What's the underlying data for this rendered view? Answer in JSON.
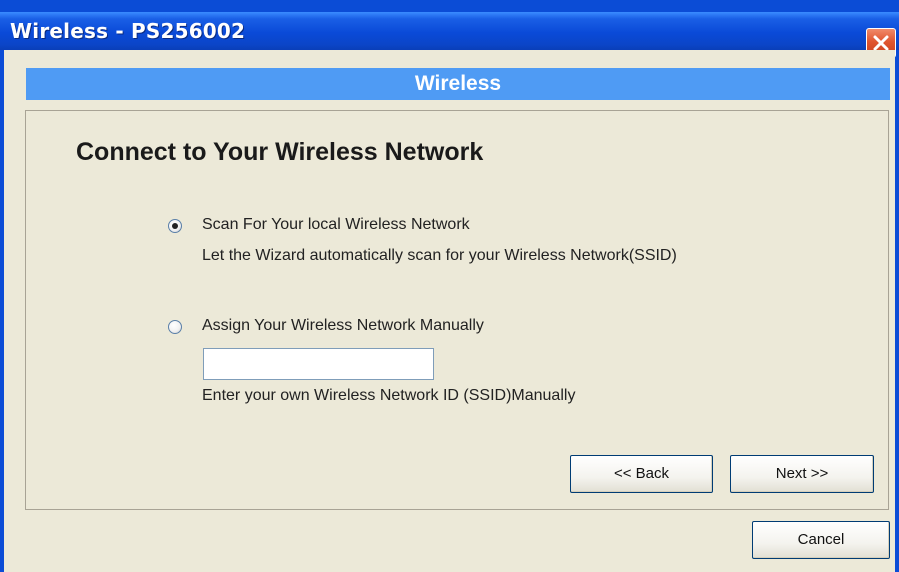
{
  "window": {
    "title": "Wireless - PS256002"
  },
  "banner": {
    "title": "Wireless"
  },
  "main": {
    "heading": "Connect to Your Wireless Network",
    "options": [
      {
        "label": "Scan For Your local Wireless Network",
        "description": "Let the Wizard automatically scan for your Wireless Network(SSID)",
        "selected": true
      },
      {
        "label": "Assign Your Wireless Network Manually",
        "description": "Enter your own Wireless Network ID (SSID)Manually",
        "selected": false
      }
    ],
    "ssid_input": {
      "value": "",
      "placeholder": ""
    }
  },
  "buttons": {
    "back": "<< Back",
    "next": "Next >>",
    "cancel": "Cancel"
  },
  "colors": {
    "titlebar": "#0a4ad8",
    "banner": "#4f9bf4",
    "dialog_bg": "#ece9d8",
    "close_button": "#e0552f"
  },
  "icons": {
    "close": "close-icon"
  }
}
